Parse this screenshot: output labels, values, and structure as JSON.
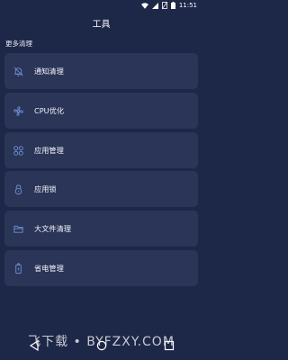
{
  "status_bar": {
    "time": "11:51",
    "icons": [
      "wifi-icon",
      "signal-icon",
      "no-sim-icon",
      "battery-icon"
    ]
  },
  "header": {
    "title": "工具"
  },
  "section": {
    "label": "更多清理"
  },
  "tools": [
    {
      "label": "通知清理",
      "icon": "bell-icon"
    },
    {
      "label": "CPU优化",
      "icon": "fan-icon"
    },
    {
      "label": "应用管理",
      "icon": "apps-grid-icon"
    },
    {
      "label": "应用锁",
      "icon": "lock-icon"
    },
    {
      "label": "大文件清理",
      "icon": "folder-icon"
    },
    {
      "label": "省电管理",
      "icon": "battery-icon"
    }
  ],
  "watermark": {
    "text": "飞下载 • BYFZXY.COM"
  },
  "nav": {
    "icons": [
      "back-icon",
      "home-icon",
      "recents-icon"
    ]
  },
  "colors": {
    "background": "#1d2747",
    "card": "#2a3557",
    "icon": "#6f8fd6"
  }
}
